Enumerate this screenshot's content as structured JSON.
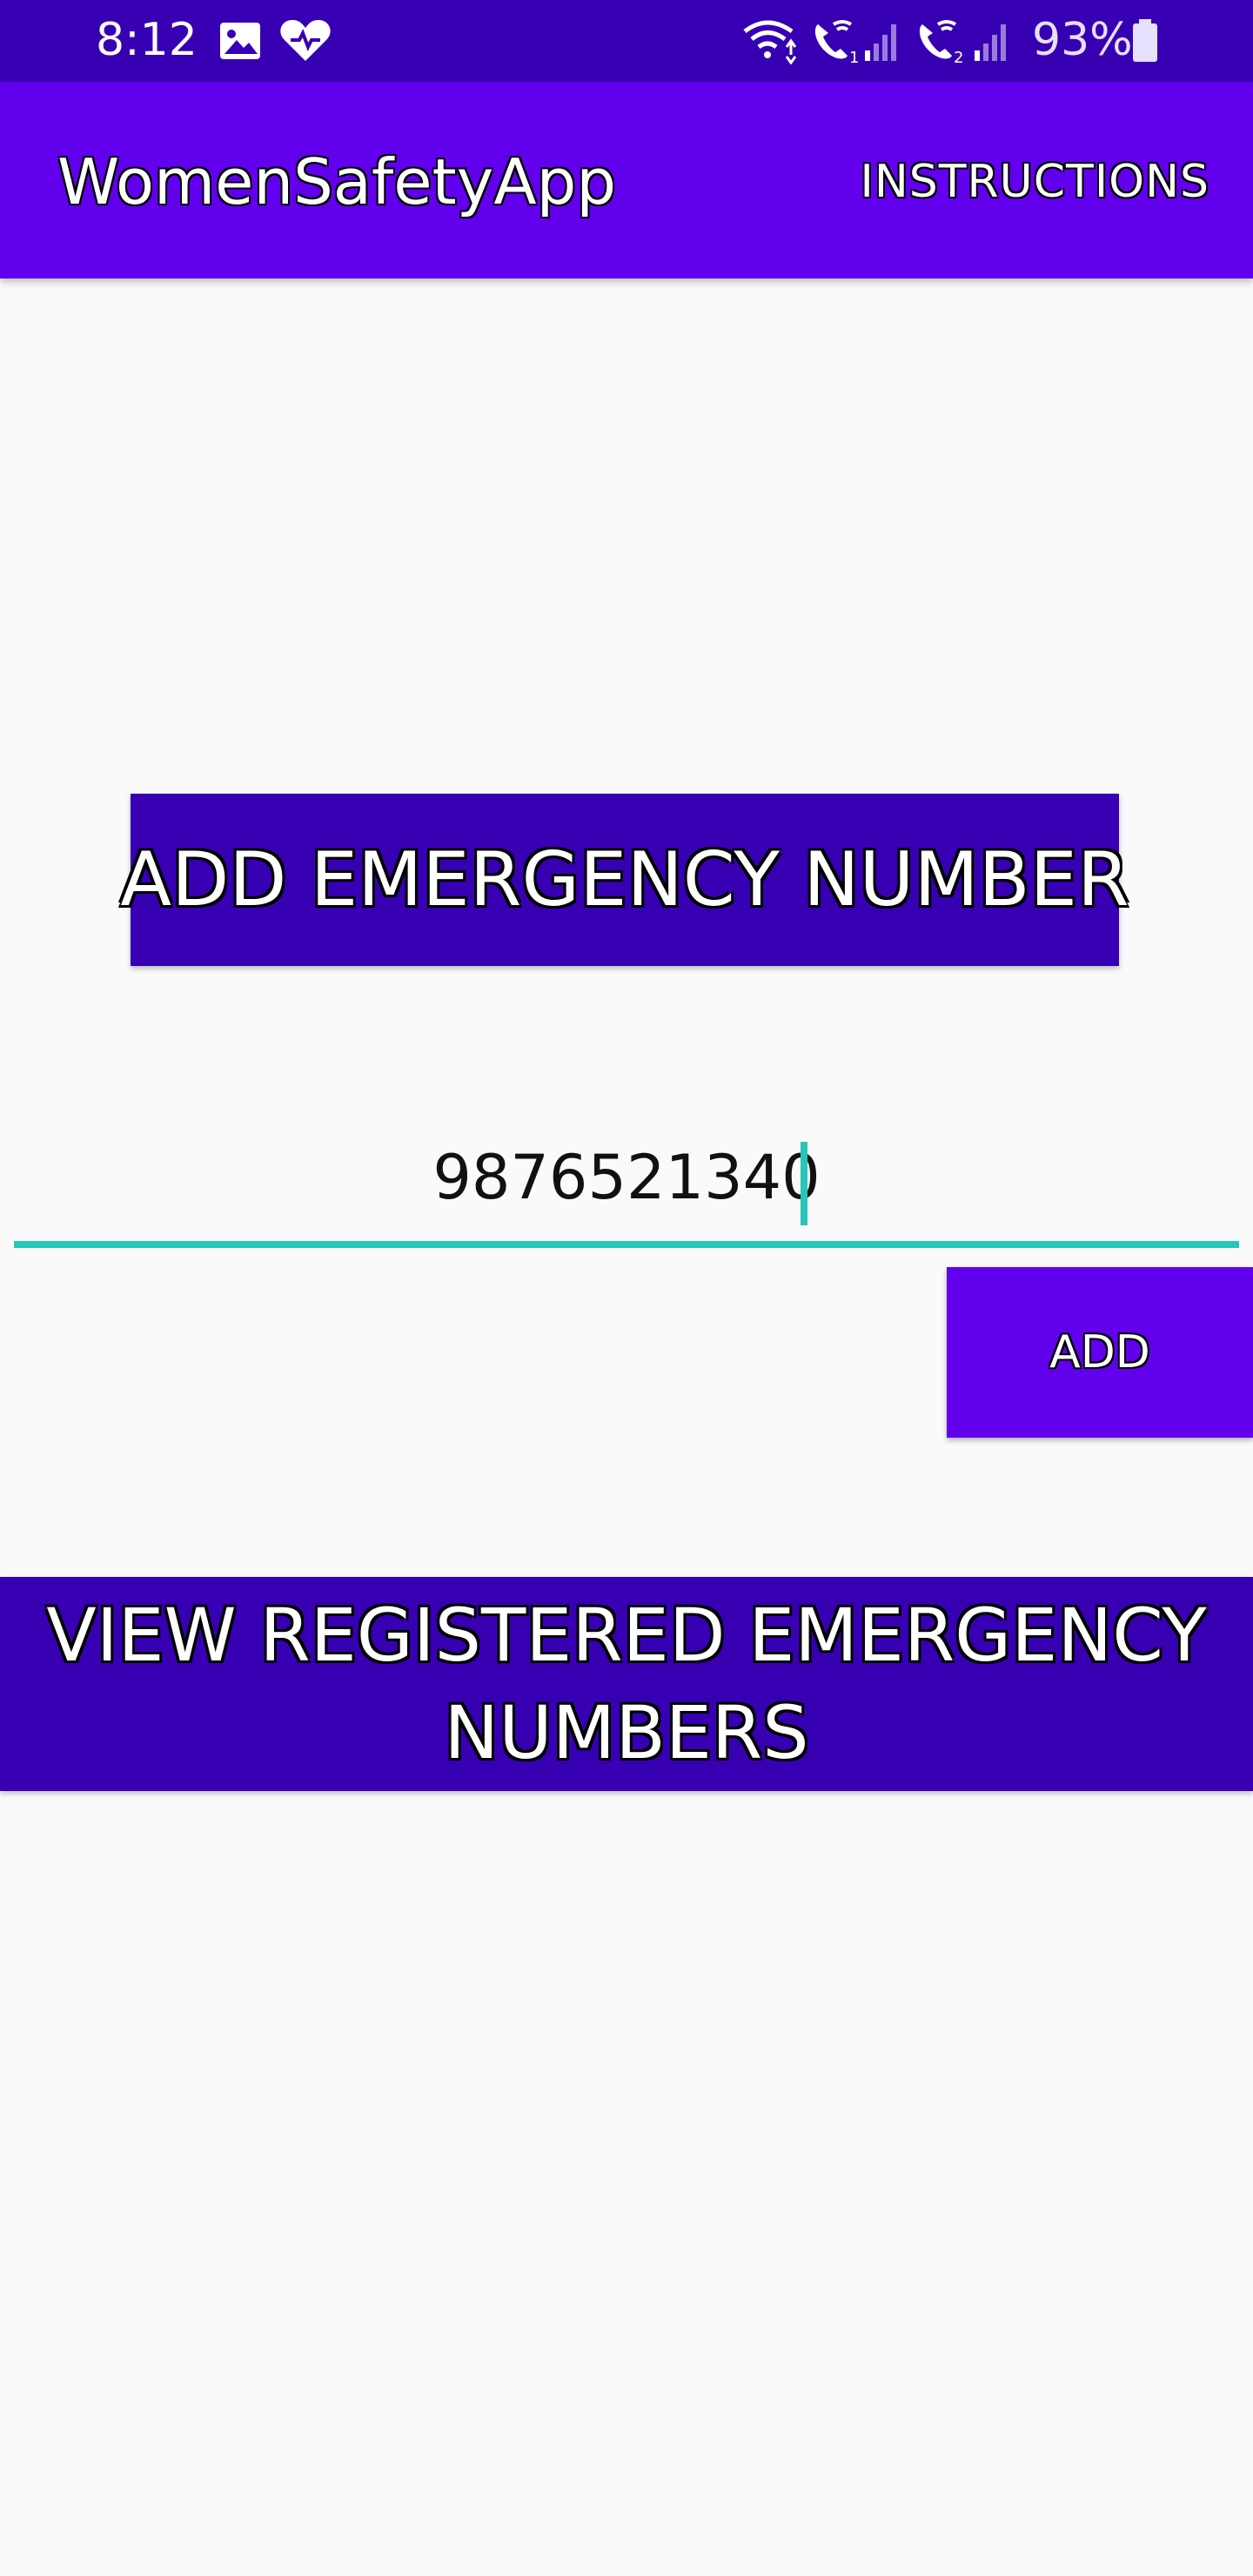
{
  "status_bar": {
    "time": "8:12",
    "battery_text": "93%",
    "icons": [
      "gallery-icon",
      "health-heart-icon",
      "wifi-icon",
      "wifi-call-1-icon",
      "signal-1-icon",
      "wifi-call-2-icon",
      "signal-2-icon",
      "battery-icon"
    ]
  },
  "app_bar": {
    "title": "WomenSafetyApp",
    "action_label": "INSTRUCTIONS"
  },
  "main": {
    "header_label": "ADD EMERGENCY NUMBER",
    "phone_input_value": "9876521340",
    "add_button_label": "ADD",
    "view_button_label": "VIEW REGISTERED EMERGENCY NUMBERS"
  },
  "colors": {
    "primary": "#6200ee",
    "primary_dark": "#3700b3",
    "accent": "#26c6b8",
    "background": "#fafafa"
  }
}
